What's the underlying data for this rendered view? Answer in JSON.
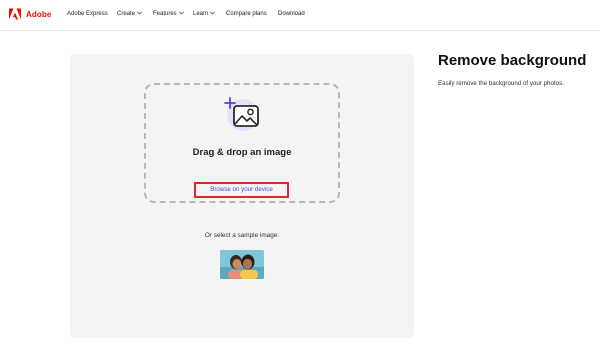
{
  "header": {
    "brand": "Adobe",
    "nav": [
      {
        "label": "Adobe Express",
        "has_dropdown": false
      },
      {
        "label": "Create",
        "has_dropdown": true
      },
      {
        "label": "Features",
        "has_dropdown": true
      },
      {
        "label": "Learn",
        "has_dropdown": true
      },
      {
        "label": "Compare plans",
        "has_dropdown": false
      },
      {
        "label": "Download",
        "has_dropdown": false
      }
    ]
  },
  "upload": {
    "title": "Drag & drop an image",
    "browse_label": "Browse on your device",
    "sample_label": "Or select a sample image:",
    "icon": "add-image-icon"
  },
  "intro": {
    "title": "Remove background",
    "subtitle": "Easily remove the background of your photos."
  },
  "colors": {
    "brand_red": "#eb1000",
    "link": "#4a47d6",
    "highlight_border": "#e3262b",
    "panel_bg": "#f4f4f4"
  }
}
